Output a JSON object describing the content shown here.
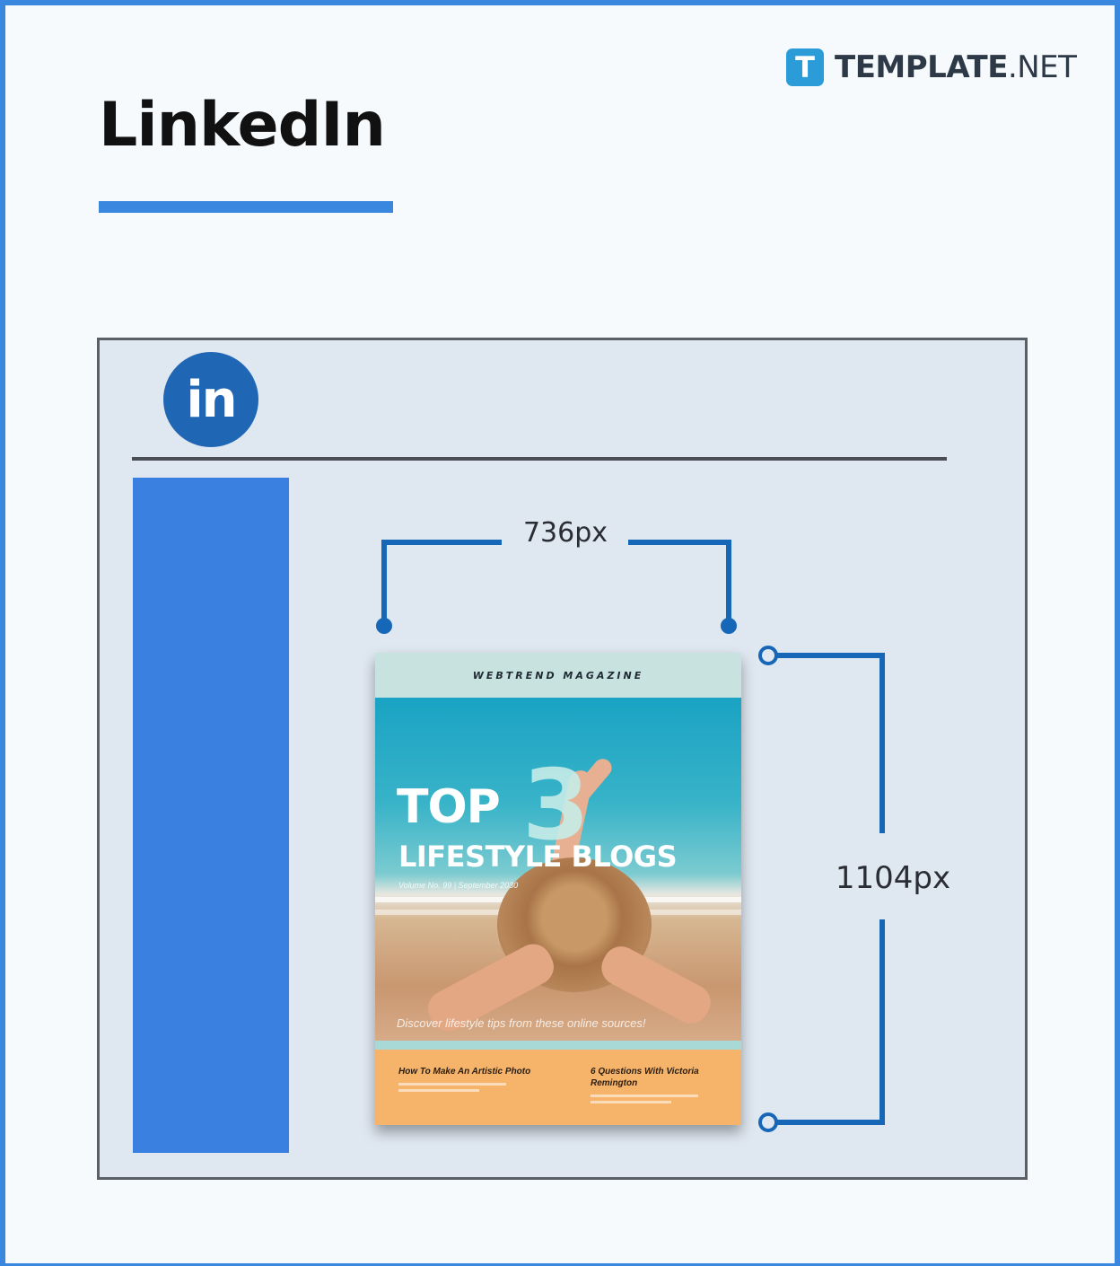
{
  "header": {
    "title": "LinkedIn",
    "brand": {
      "icon": "T",
      "name_bold": "TEMPLATE",
      "name_suffix": ".NET"
    }
  },
  "mockup": {
    "platform_icon_text": "in",
    "dimensions": {
      "width_label": "736px",
      "height_label": "1104px"
    }
  },
  "magazine": {
    "publisher": "WEBTREND MAGAZINE",
    "headline_top": "TOP",
    "headline_number": "3",
    "headline_sub": "LIFESTYLE BLOGS",
    "issue": "Volume No. 99 | September 2030",
    "tagline": "Discover lifestyle tips from these online sources!",
    "articles": [
      {
        "title": "How To Make An Artistic Photo"
      },
      {
        "title": "6 Questions With Victoria Remington"
      }
    ]
  },
  "colors": {
    "accent": "#3a87e0",
    "linkedin": "#1f66b5",
    "guide": "#1667b8"
  }
}
